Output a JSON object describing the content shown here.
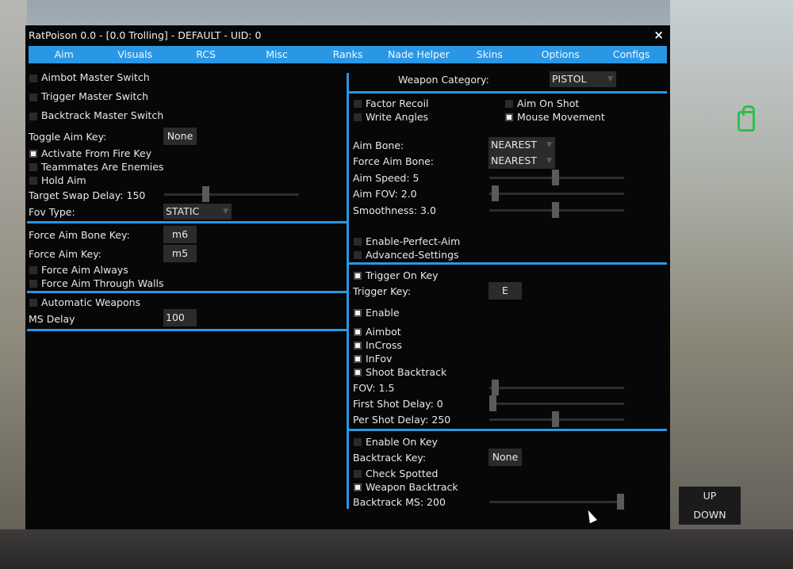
{
  "window": {
    "title": "RatPoison 0.0 - [0.0 Trolling] - DEFAULT - UID: 0",
    "close": "×"
  },
  "tabs": [
    "Aim",
    "Visuals",
    "RCS",
    "Misc",
    "Ranks",
    "Nade Helper",
    "Skins",
    "Options",
    "Configs"
  ],
  "left": {
    "master": {
      "aimbot_master": {
        "label": "Aimbot Master Switch",
        "checked": false
      },
      "trigger_master": {
        "label": "Trigger Master Switch",
        "checked": false
      },
      "backtrack_master": {
        "label": "Backtrack Master Switch",
        "checked": false
      }
    },
    "toggle_aim_key": {
      "label": "Toggle Aim Key:",
      "value": "None"
    },
    "activate_from_fire_key": {
      "label": "Activate From Fire Key",
      "checked": true
    },
    "teammates_are_enemies": {
      "label": "Teammates Are Enemies",
      "checked": false
    },
    "hold_aim": {
      "label": "Hold Aim",
      "checked": false
    },
    "target_swap_delay": {
      "label": "Target Swap Delay: 150",
      "fraction": 0.3
    },
    "fov_type": {
      "label": "Fov Type:",
      "value": "STATIC"
    },
    "force_aim_bone_key": {
      "label": "Force Aim Bone Key:",
      "value": "m6"
    },
    "force_aim_key": {
      "label": "Force Aim Key:",
      "value": "m5"
    },
    "force_aim_always": {
      "label": "Force Aim Always",
      "checked": false
    },
    "force_aim_through_walls": {
      "label": "Force Aim Through Walls",
      "checked": false
    },
    "automatic_weapons": {
      "label": "Automatic Weapons",
      "checked": false
    },
    "ms_delay": {
      "label": "MS Delay",
      "value": "100"
    }
  },
  "right": {
    "weapon_category": {
      "label": "Weapon Category:",
      "value": "PISTOL"
    },
    "factor_recoil": {
      "label": "Factor Recoil",
      "checked": false
    },
    "aim_on_shot": {
      "label": "Aim On Shot",
      "checked": false
    },
    "write_angles": {
      "label": "Write Angles",
      "checked": false
    },
    "mouse_movement": {
      "label": "Mouse Movement",
      "checked": true
    },
    "aim_bone": {
      "label": "Aim Bone:",
      "value": "NEAREST"
    },
    "force_aim_bone": {
      "label": "Force Aim Bone:",
      "value": "NEAREST"
    },
    "aim_speed": {
      "label": "Aim Speed: 5",
      "fraction": 0.49
    },
    "aim_fov": {
      "label": "Aim FOV: 2.0",
      "fraction": 0.02
    },
    "smoothness": {
      "label": "Smoothness: 3.0",
      "fraction": 0.49
    },
    "enable_perfect_aim": {
      "label": "Enable-Perfect-Aim",
      "checked": false
    },
    "advanced_settings": {
      "label": "Advanced-Settings",
      "checked": false
    },
    "trigger_on_key": {
      "label": "Trigger On Key",
      "checked": true
    },
    "trigger_key": {
      "label": "Trigger Key:",
      "value": "E"
    },
    "trigger_enable": {
      "label": "Enable",
      "checked": true
    },
    "trigger_aimbot": {
      "label": "Aimbot",
      "checked": true
    },
    "incross": {
      "label": "InCross",
      "checked": true
    },
    "infov": {
      "label": "InFov",
      "checked": true
    },
    "shoot_backtrack": {
      "label": "Shoot Backtrack",
      "checked": true
    },
    "trigger_fov": {
      "label": "FOV: 1.5",
      "fraction": 0.02
    },
    "first_shot_delay": {
      "label": "First Shot Delay: 0",
      "fraction": 0.0
    },
    "per_shot_delay": {
      "label": "Per Shot Delay: 250",
      "fraction": 0.49
    },
    "enable_on_key": {
      "label": "Enable On Key",
      "checked": false
    },
    "backtrack_key": {
      "label": "Backtrack Key:",
      "value": "None"
    },
    "check_spotted": {
      "label": "Check Spotted",
      "checked": false
    },
    "weapon_backtrack": {
      "label": "Weapon Backtrack",
      "checked": true
    },
    "backtrack_ms": {
      "label": "Backtrack MS: 200",
      "fraction": 1.0
    }
  },
  "updown": {
    "up": "UP",
    "down": "DOWN"
  },
  "colors": {
    "accent": "#2997e5",
    "window_bg": "#070707",
    "control_bg": "#2b2b2b"
  }
}
